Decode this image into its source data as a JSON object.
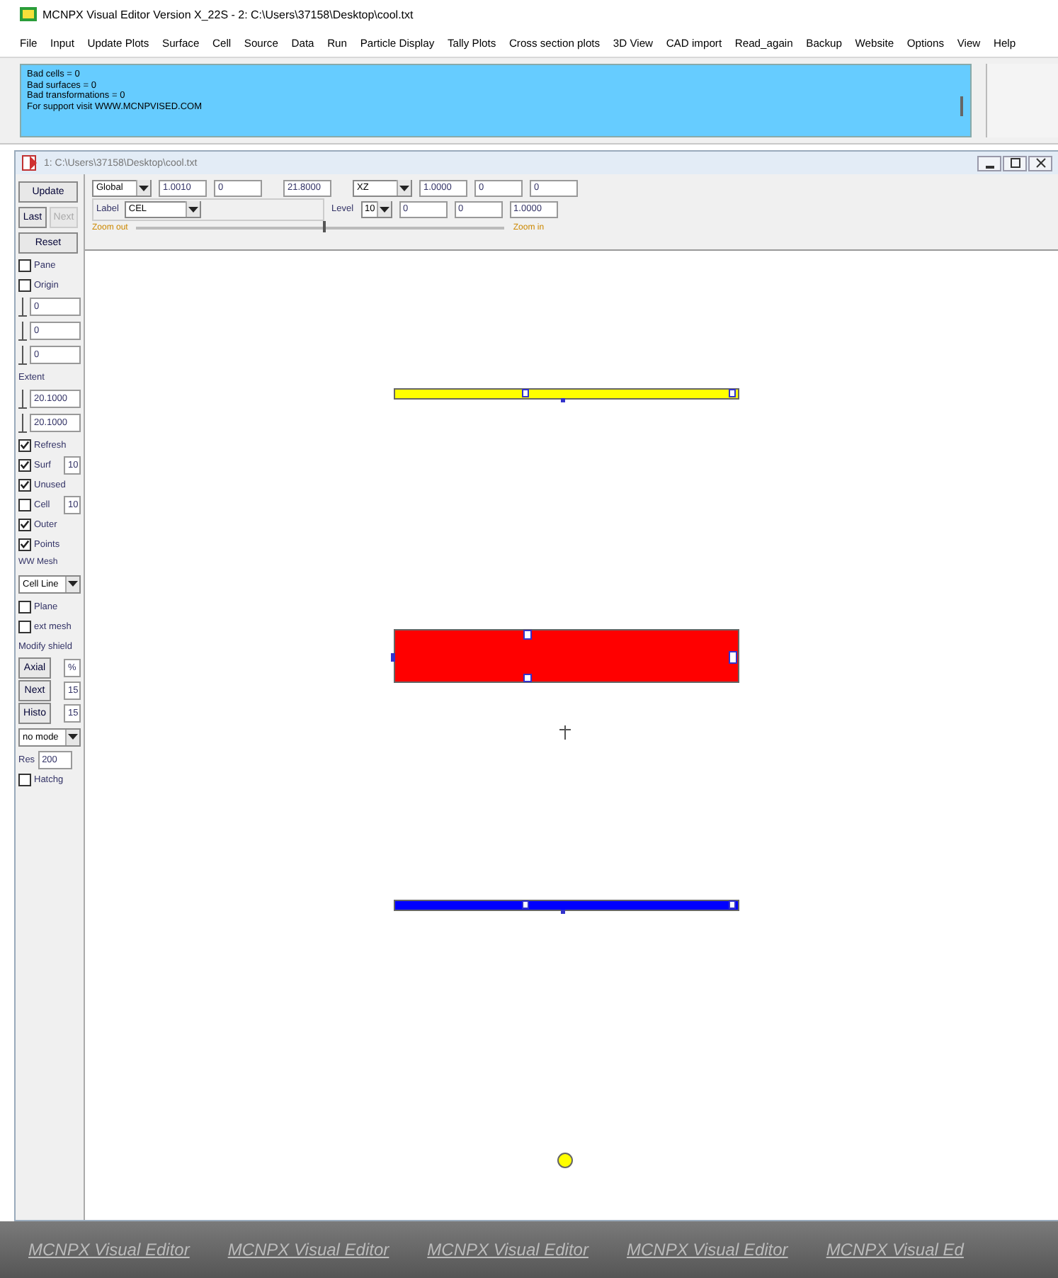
{
  "window": {
    "title": "MCNPX Visual Editor Version X_22S - 2: C:\\Users\\37158\\Desktop\\cool.txt"
  },
  "menu": [
    "File",
    "Input",
    "Update Plots",
    "Surface",
    "Cell",
    "Source",
    "Data",
    "Run",
    "Particle Display",
    "Tally Plots",
    "Cross section plots",
    "3D View",
    "CAD import",
    "Read_again",
    "Backup",
    "Website",
    "Options",
    "View",
    "Help"
  ],
  "messages": [
    "Bad cells = 0",
    "Bad surfaces = 0",
    "Bad transformations = 0",
    "For support visit WWW.MCNPVISED.COM"
  ],
  "document": {
    "title": "1: C:\\Users\\37158\\Desktop\\cool.txt",
    "toolbar": {
      "basis": "Global",
      "origin": [
        "1.0010",
        "0",
        "21.8000"
      ],
      "plane": "XZ",
      "row1": [
        "1.0000",
        "0",
        "0"
      ],
      "row2": [
        "0",
        "0",
        "1.0000"
      ],
      "label_caption": "Label",
      "label": "CEL",
      "level_caption": "Level",
      "level": "10",
      "zoom_out": "Zoom out",
      "zoom_in": "Zoom in",
      "zoom": {
        "level": 0.51
      }
    },
    "sidebar": [
      {
        "kind": "button",
        "label": "Update"
      },
      {
        "kind": "pair",
        "buttons": [
          {
            "label": "Last",
            "disabled": false
          },
          {
            "label": "Next",
            "disabled": true
          }
        ]
      },
      {
        "kind": "button",
        "label": "Reset"
      },
      {
        "kind": "check",
        "label": "Pane",
        "checked": false
      },
      {
        "kind": "check",
        "label": "Origin",
        "checked": false
      },
      {
        "kind": "spin",
        "value": "0"
      },
      {
        "kind": "spin",
        "value": "0"
      },
      {
        "kind": "spin",
        "value": "0"
      },
      {
        "kind": "label",
        "text": "Extent"
      },
      {
        "kind": "spin",
        "value": "20.1000"
      },
      {
        "kind": "spin",
        "value": "20.1000"
      },
      {
        "kind": "check",
        "label": "Refresh",
        "checked": true
      },
      {
        "kind": "checkfield",
        "label": "Surf",
        "checked": true,
        "value": "10"
      },
      {
        "kind": "check",
        "label": "Unused",
        "checked": true
      },
      {
        "kind": "checkfield",
        "label": "Cell",
        "checked": false,
        "value": "10"
      },
      {
        "kind": "check",
        "label": "Outer",
        "checked": true
      },
      {
        "kind": "check",
        "label": "Points",
        "checked": true
      },
      {
        "kind": "group",
        "text": "WW Mesh"
      },
      {
        "kind": "dropdown",
        "value": "Cell Line"
      },
      {
        "kind": "check",
        "label": "Plane",
        "checked": false
      },
      {
        "kind": "check",
        "label": "ext mesh",
        "checked": false
      },
      {
        "kind": "label",
        "text": "Modify shield"
      },
      {
        "kind": "buttonfield",
        "label": "Axial",
        "value": "%"
      },
      {
        "kind": "buttonfield",
        "label": "Next",
        "value": "15"
      },
      {
        "kind": "buttonfield",
        "label": "Histo",
        "value": "15"
      },
      {
        "kind": "dropdown",
        "value": "no mode"
      },
      {
        "kind": "labelfield",
        "label": "Res",
        "value": "200"
      },
      {
        "kind": "check",
        "label": "Hatchg",
        "checked": false
      }
    ]
  },
  "canvas": {
    "shapes": [
      {
        "kind": "bar",
        "color": "#ffff00"
      },
      {
        "kind": "slab",
        "color": "#ff0000"
      },
      {
        "kind": "cross"
      },
      {
        "kind": "bar",
        "color": "#0000ff"
      },
      {
        "kind": "dot",
        "color": "#ffff00"
      }
    ]
  },
  "footer": [
    "MCNPX Visual Editor",
    "MCNPX Visual Editor",
    "MCNPX Visual Editor",
    "MCNPX Visual Editor",
    "MCNPX Visual Ed"
  ]
}
